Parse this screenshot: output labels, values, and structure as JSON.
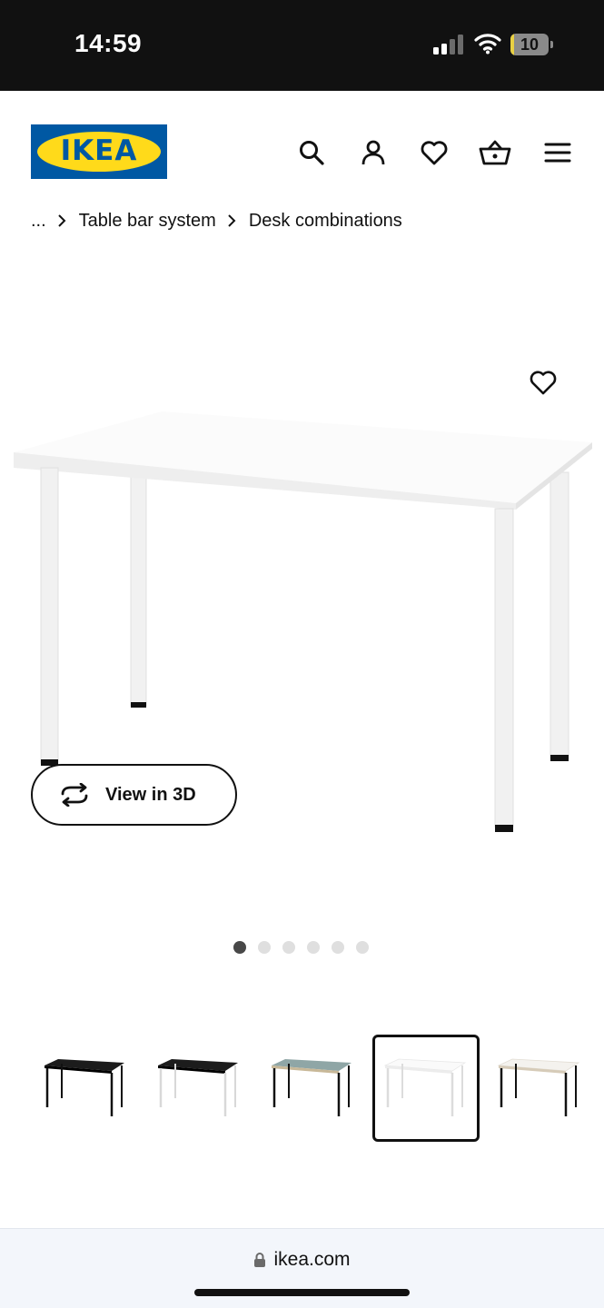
{
  "status_bar": {
    "time": "14:59",
    "battery": "10",
    "battery_level": 0.1,
    "signal_icon": "cellular-signal-icon",
    "wifi_icon": "wifi-icon"
  },
  "header": {
    "logo_text": "IKEA",
    "colors": {
      "brand_blue": "#0058a3",
      "brand_yellow": "#ffda1a"
    },
    "icons": [
      "search-icon",
      "account-icon",
      "favourites-heart-icon",
      "shopping-basket-icon",
      "menu-icon"
    ]
  },
  "breadcrumb": {
    "ellipsis": "...",
    "items": [
      "Table bar system",
      "Desk combinations"
    ]
  },
  "product": {
    "favourite_icon": "heart-icon",
    "view_3d_label": "View in 3D",
    "view_3d_icon": "rotate-3d-icon",
    "image_pages": 6,
    "active_page": 1
  },
  "thumbnails": [
    {
      "top": "black",
      "legs": "black",
      "selected": false
    },
    {
      "top": "black",
      "legs": "white",
      "selected": false
    },
    {
      "top": "grey-turquoise",
      "legs": "black",
      "selected": false
    },
    {
      "top": "white",
      "legs": "white",
      "selected": true
    },
    {
      "top": "white",
      "legs": "black",
      "selected": false
    }
  ],
  "browser": {
    "url": "ikea.com",
    "lock_icon": "lock-icon"
  }
}
